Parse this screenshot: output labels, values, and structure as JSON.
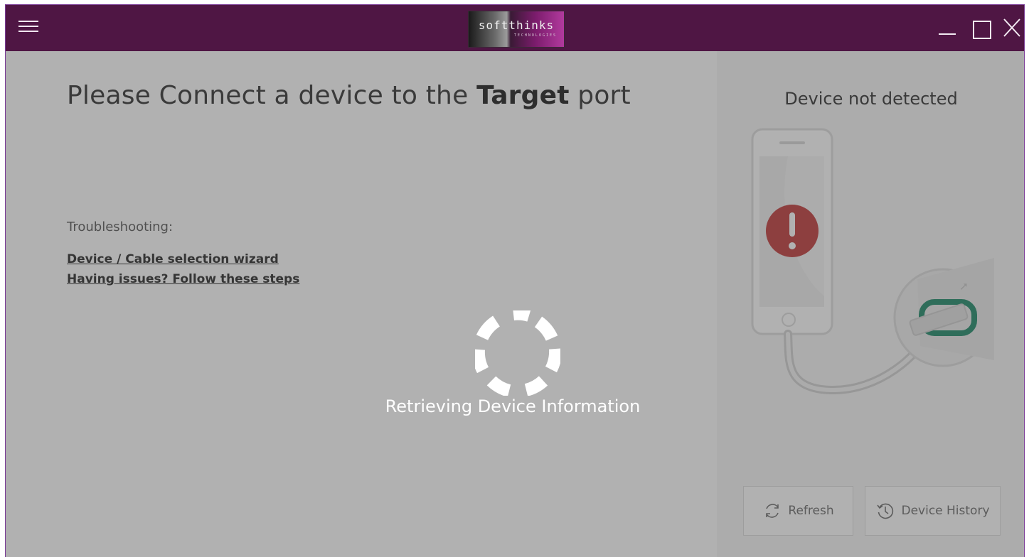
{
  "titlebar": {
    "logo_text": "softthinks",
    "logo_subtext": "TECHNOLOGIES",
    "menu_icon": "hamburger-icon",
    "minimize_icon": "minimize-icon",
    "maximize_icon": "maximize-icon",
    "close_icon": "close-icon",
    "background_color": "#4f1644"
  },
  "main": {
    "headline_prefix": "Please Connect a device to the ",
    "headline_bold": "Target",
    "headline_suffix": " port",
    "troubleshooting_label": "Troubleshooting:",
    "links": [
      "Device / Cable selection wizard",
      "Having issues? Follow these steps"
    ]
  },
  "side": {
    "status_title": "Device not detected",
    "illustration_icon": "phone-usb-error-icon",
    "buttons": {
      "refresh": {
        "label": "Refresh",
        "icon": "refresh-icon"
      },
      "history": {
        "label": "Device History",
        "icon": "history-icon"
      }
    }
  },
  "overlay": {
    "spinner_icon": "loading-spinner-icon",
    "message": "Retrieving Device Information"
  },
  "colors": {
    "accent": "#4f1644",
    "error": "#c23b3b",
    "usb_port": "#1f8a6a"
  }
}
